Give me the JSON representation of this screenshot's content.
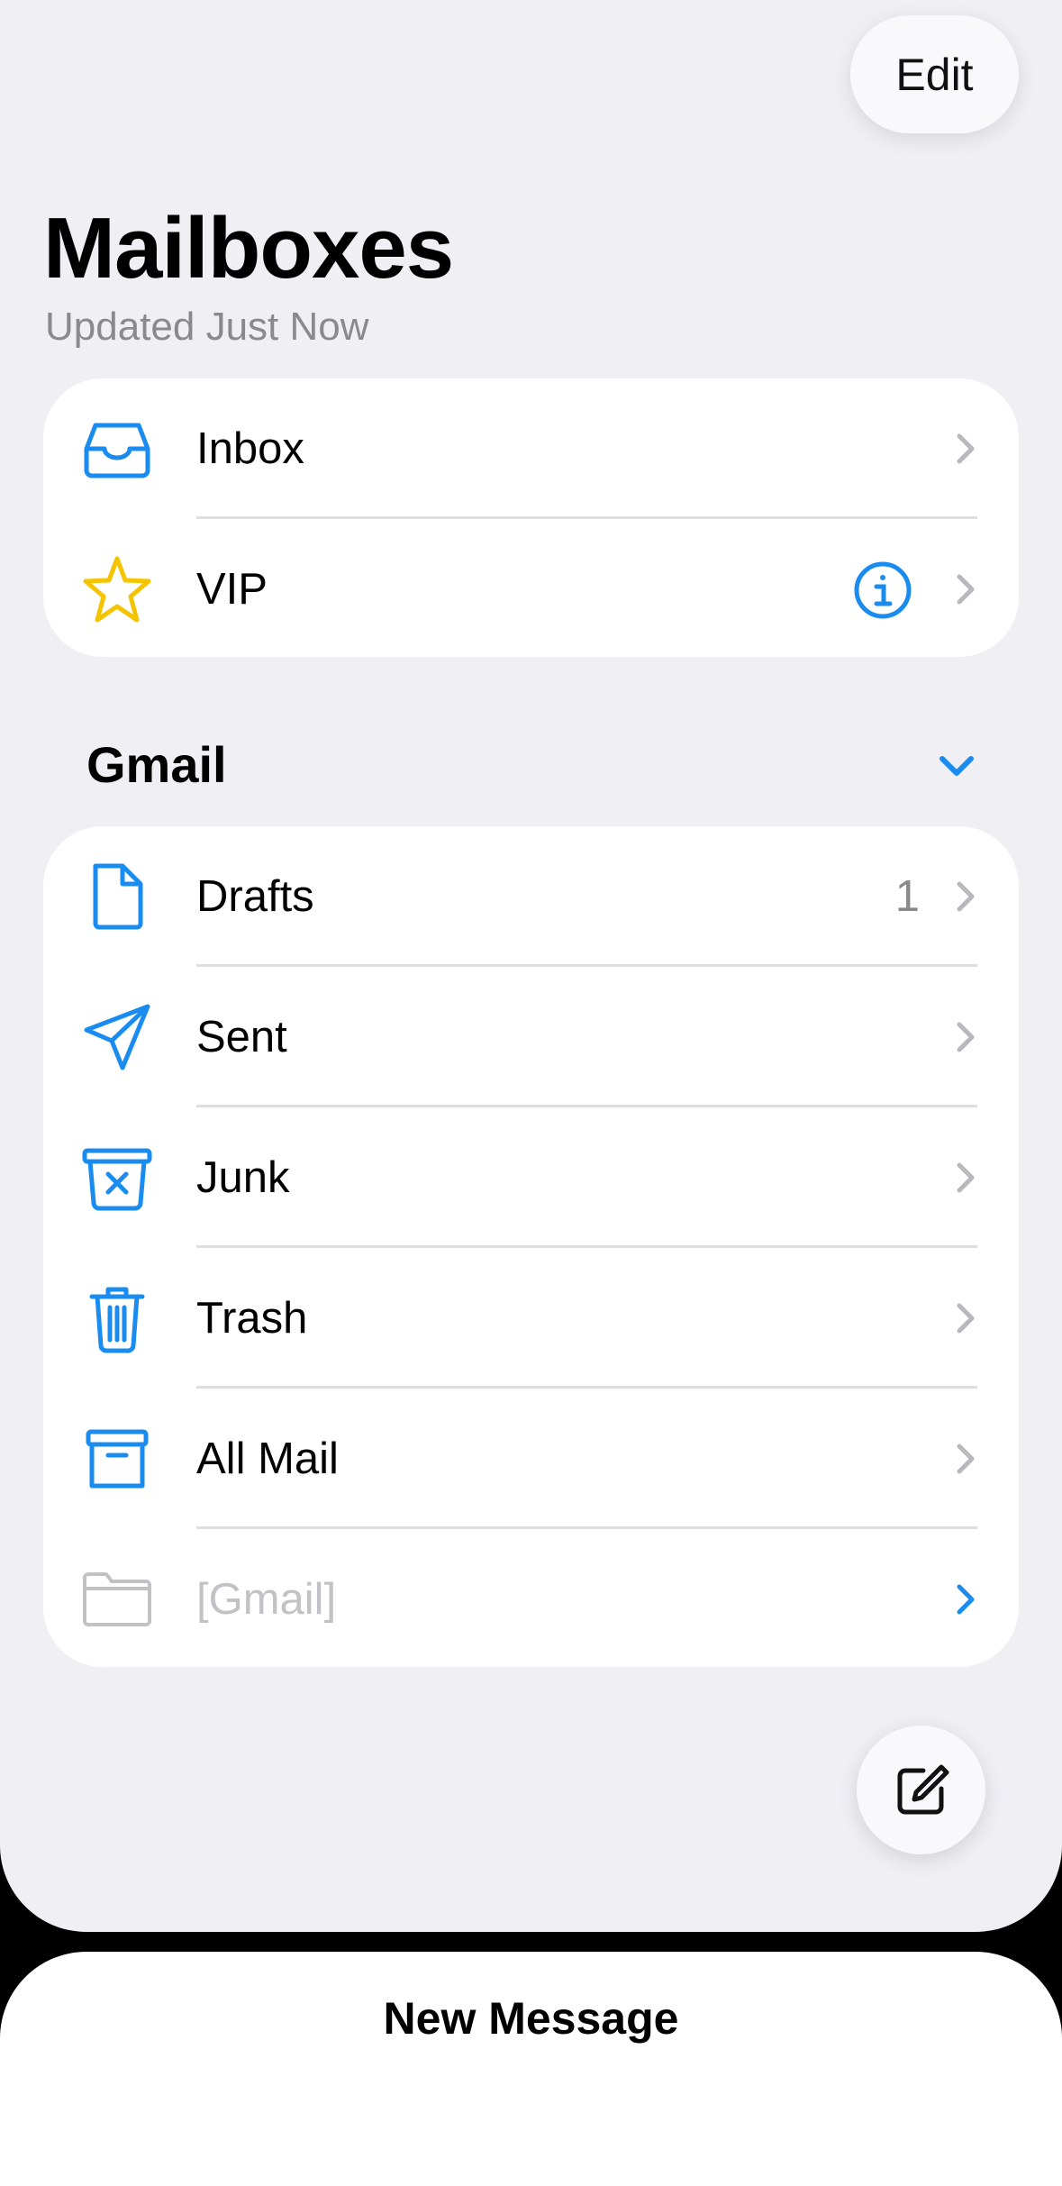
{
  "header": {
    "edit_label": "Edit",
    "title": "Mailboxes",
    "subtitle": "Updated Just Now"
  },
  "favorites": [
    {
      "label": "Inbox",
      "icon": "inbox-tray-icon"
    },
    {
      "label": "VIP",
      "icon": "star-icon"
    }
  ],
  "account": {
    "name": "Gmail",
    "expanded": true,
    "folders": [
      {
        "label": "Drafts",
        "icon": "document-icon",
        "count": "1"
      },
      {
        "label": "Sent",
        "icon": "paper-plane-icon",
        "count": ""
      },
      {
        "label": "Junk",
        "icon": "junk-bin-icon",
        "count": ""
      },
      {
        "label": "Trash",
        "icon": "trash-icon",
        "count": ""
      },
      {
        "label": "All Mail",
        "icon": "archive-box-icon",
        "count": ""
      },
      {
        "label": "[Gmail]",
        "icon": "folder-icon",
        "count": ""
      }
    ]
  },
  "compose": {
    "icon": "compose-icon"
  },
  "sheet": {
    "title": "New Message"
  },
  "colors": {
    "accent": "#1a8cf0",
    "star": "#f5c400",
    "background": "#efeff4",
    "disabled": "#c2c2c6"
  }
}
